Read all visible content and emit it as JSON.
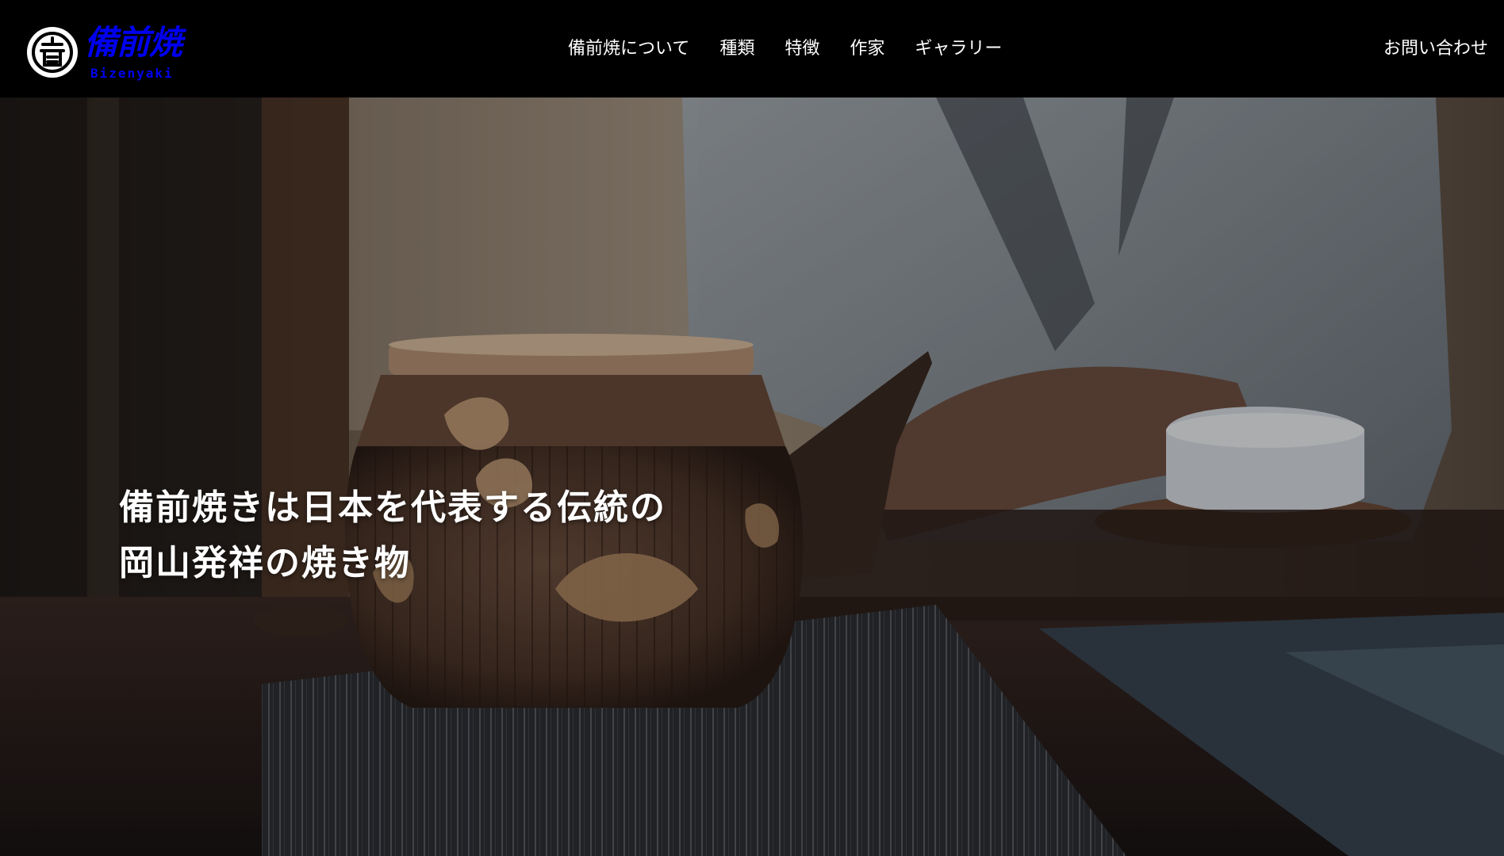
{
  "header": {
    "logo": {
      "kanji": "備前焼",
      "roman": "Bizenyaki",
      "mark_icon": "bizen-crest-icon"
    },
    "nav": [
      {
        "label": "備前焼について"
      },
      {
        "label": "種類"
      },
      {
        "label": "特徴"
      },
      {
        "label": "作家"
      },
      {
        "label": "ギャラリー"
      }
    ],
    "contact_label": "お問い合わせ"
  },
  "hero": {
    "headline_line1": "備前焼きは日本を代表する伝統の",
    "headline_line2": "岡山発祥の焼き物",
    "image_subject": "teapot-photo",
    "colors": {
      "header_bg": "#000000",
      "text": "#ffffff"
    }
  }
}
